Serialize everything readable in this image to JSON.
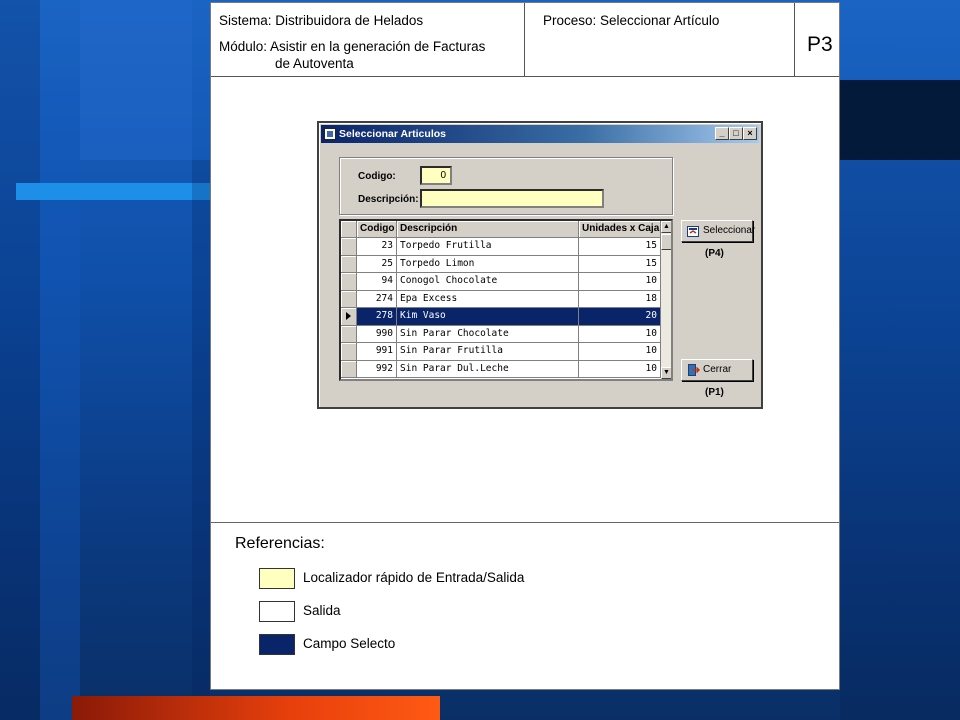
{
  "header": {
    "system": "Sistema: Distribuidora de Helados",
    "module_line1": "Módulo: Asistir en la generación de Facturas",
    "module_line2": "de Autoventa",
    "process": "Proceso: Seleccionar Artículo",
    "page_code": "P3"
  },
  "dialog": {
    "title": "Seleccionar Articulos",
    "window_buttons": {
      "minimize": "_",
      "maximize": "□",
      "close": "×"
    },
    "filter": {
      "code_label": "Codigo:",
      "code_value": "0",
      "desc_label": "Descripción:",
      "desc_value": ""
    },
    "grid": {
      "headers": {
        "code": "Codigo",
        "desc": "Descripción",
        "qty": "Unidades x Caja"
      },
      "rows": [
        {
          "code": "23",
          "desc": "Torpedo Frutilla",
          "qty": "15"
        },
        {
          "code": "25",
          "desc": "Torpedo Limon",
          "qty": "15"
        },
        {
          "code": "94",
          "desc": "Conogol Chocolate",
          "qty": "10"
        },
        {
          "code": "274",
          "desc": "Epa Excess",
          "qty": "18"
        },
        {
          "code": "278",
          "desc": "Kim Vaso",
          "qty": "20"
        },
        {
          "code": "990",
          "desc": "Sin Parar Chocolate",
          "qty": "10"
        },
        {
          "code": "991",
          "desc": "Sin Parar Frutilla",
          "qty": "10"
        },
        {
          "code": "992",
          "desc": "Sin Parar Dul.Leche",
          "qty": "10"
        }
      ],
      "selected_index": 4
    },
    "buttons": {
      "select_label": "Seleccionar",
      "select_ref": "(P4)",
      "close_label": "Cerrar",
      "close_ref": "(P1)"
    }
  },
  "references": {
    "title": "Referencias:",
    "items": [
      {
        "label": "Localizador rápido de Entrada/Salida",
        "color": "#ffffc0"
      },
      {
        "label": "Salida",
        "color": "#ffffff"
      },
      {
        "label": "Campo Selecto",
        "color": "#0a246a"
      }
    ]
  },
  "colors": {
    "selection": "#0a246a",
    "input_fill": "#ffffc0",
    "dialog_face": "#d4d0c8"
  }
}
